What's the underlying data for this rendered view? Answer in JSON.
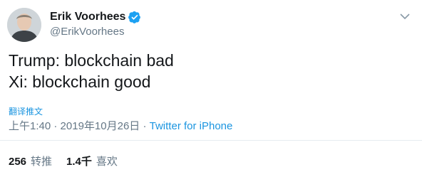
{
  "author": {
    "display_name": "Erik Voorhees",
    "handle": "@ErikVoorhees",
    "verified": true
  },
  "tweet": {
    "lines": [
      "Trump: blockchain bad",
      "Xi: blockchain good"
    ],
    "translate_label": "翻译推文",
    "time": "上午1:40",
    "separator": " · ",
    "date": "2019年10月26日",
    "source": "Twitter for iPhone"
  },
  "stats": {
    "retweets_count": "256",
    "retweets_label": "转推",
    "likes_count": "1.4千",
    "likes_label": "喜欢"
  },
  "colors": {
    "link": "#1b95e0",
    "verified_badge": "#1da1f2",
    "muted": "#657786",
    "text": "#14171a"
  }
}
